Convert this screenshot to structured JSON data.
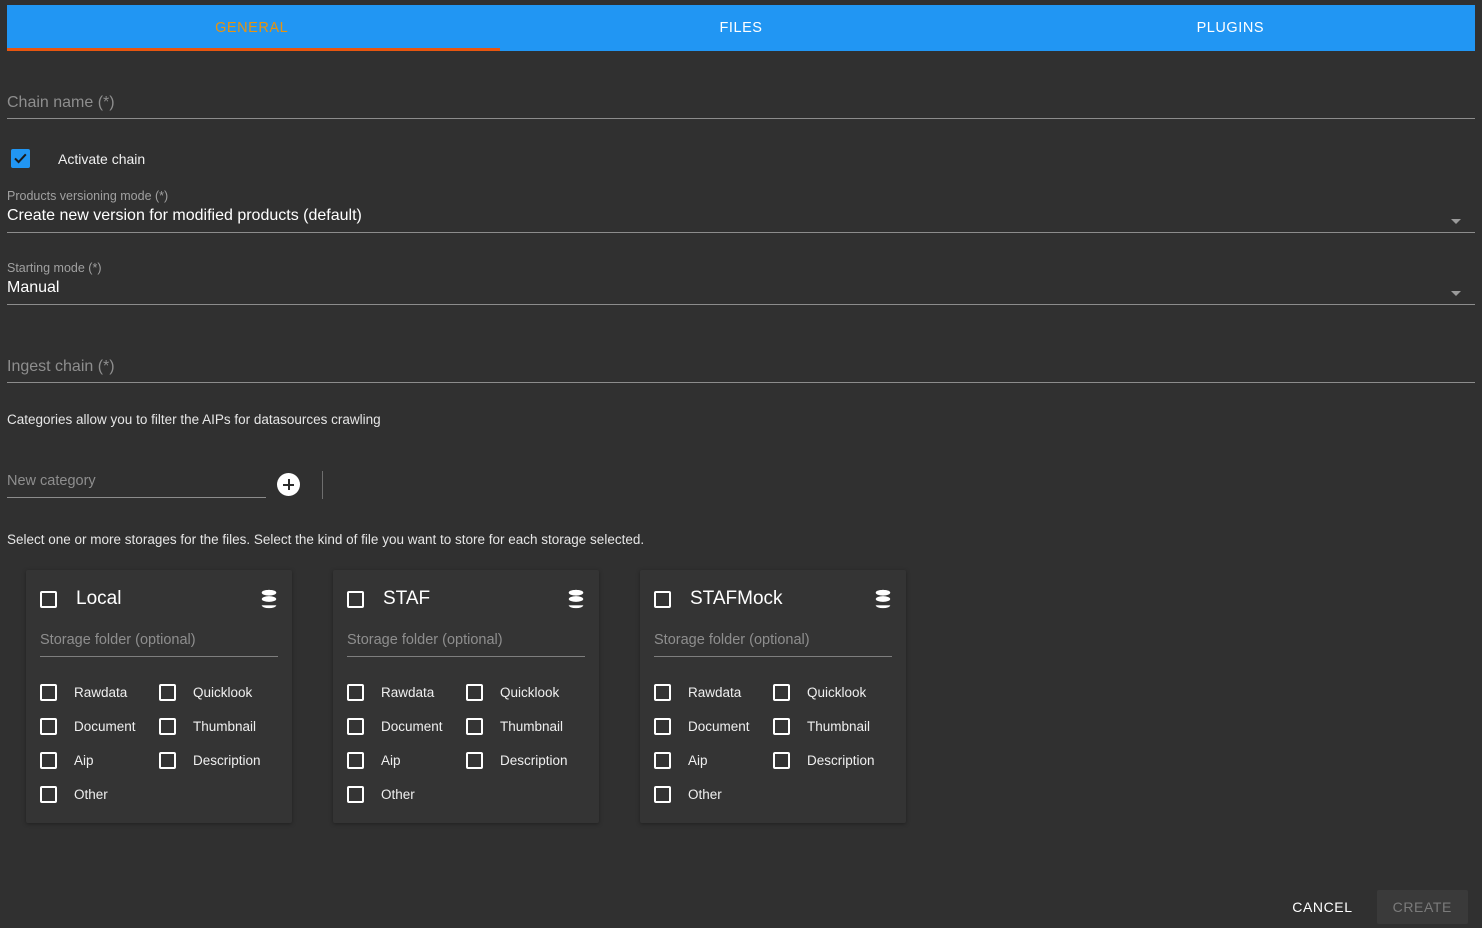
{
  "tabs": [
    {
      "label": "GENERAL",
      "active": true
    },
    {
      "label": "FILES",
      "active": false
    },
    {
      "label": "PLUGINS",
      "active": false
    }
  ],
  "colors": {
    "tab_bar": "#2196f3",
    "active_tab_text": "#e8930f",
    "active_tab_underline": "#e8560f",
    "page_background": "#303030",
    "card_background": "#343434",
    "checkbox_checked": "#2196f3"
  },
  "form": {
    "chain_name": {
      "placeholder": "Chain name (*)",
      "value": ""
    },
    "activate_chain": {
      "label": "Activate chain",
      "checked": true
    },
    "products_versioning_mode": {
      "label": "Products versioning mode (*)",
      "value": "Create new version for modified products (default)"
    },
    "starting_mode": {
      "label": "Starting mode (*)",
      "value": "Manual"
    },
    "ingest_chain": {
      "placeholder": "Ingest chain (*)",
      "value": ""
    },
    "categories_hint": "Categories allow you to filter the AIPs for datasources crawling",
    "new_category": {
      "placeholder": "New category",
      "value": ""
    },
    "add_category_icon": "plus-icon",
    "storages_hint": "Select one or more storages for the files. Select the kind of file you want to store for each storage selected."
  },
  "storages": [
    {
      "name": "Local",
      "checked": false,
      "icon": "database-icon",
      "folder_placeholder": "Storage folder (optional)",
      "folder_value": "",
      "file_types": [
        {
          "label": "Rawdata",
          "checked": false
        },
        {
          "label": "Quicklook",
          "checked": false
        },
        {
          "label": "Document",
          "checked": false
        },
        {
          "label": "Thumbnail",
          "checked": false
        },
        {
          "label": "Aip",
          "checked": false
        },
        {
          "label": "Description",
          "checked": false
        },
        {
          "label": "Other",
          "checked": false
        }
      ]
    },
    {
      "name": "STAF",
      "checked": false,
      "icon": "database-icon",
      "folder_placeholder": "Storage folder (optional)",
      "folder_value": "",
      "file_types": [
        {
          "label": "Rawdata",
          "checked": false
        },
        {
          "label": "Quicklook",
          "checked": false
        },
        {
          "label": "Document",
          "checked": false
        },
        {
          "label": "Thumbnail",
          "checked": false
        },
        {
          "label": "Aip",
          "checked": false
        },
        {
          "label": "Description",
          "checked": false
        },
        {
          "label": "Other",
          "checked": false
        }
      ]
    },
    {
      "name": "STAFMock",
      "checked": false,
      "icon": "database-icon",
      "folder_placeholder": "Storage folder (optional)",
      "folder_value": "",
      "file_types": [
        {
          "label": "Rawdata",
          "checked": false
        },
        {
          "label": "Quicklook",
          "checked": false
        },
        {
          "label": "Document",
          "checked": false
        },
        {
          "label": "Thumbnail",
          "checked": false
        },
        {
          "label": "Aip",
          "checked": false
        },
        {
          "label": "Description",
          "checked": false
        },
        {
          "label": "Other",
          "checked": false
        }
      ]
    }
  ],
  "footer": {
    "cancel_label": "CANCEL",
    "create_label": "CREATE",
    "create_disabled": true
  }
}
